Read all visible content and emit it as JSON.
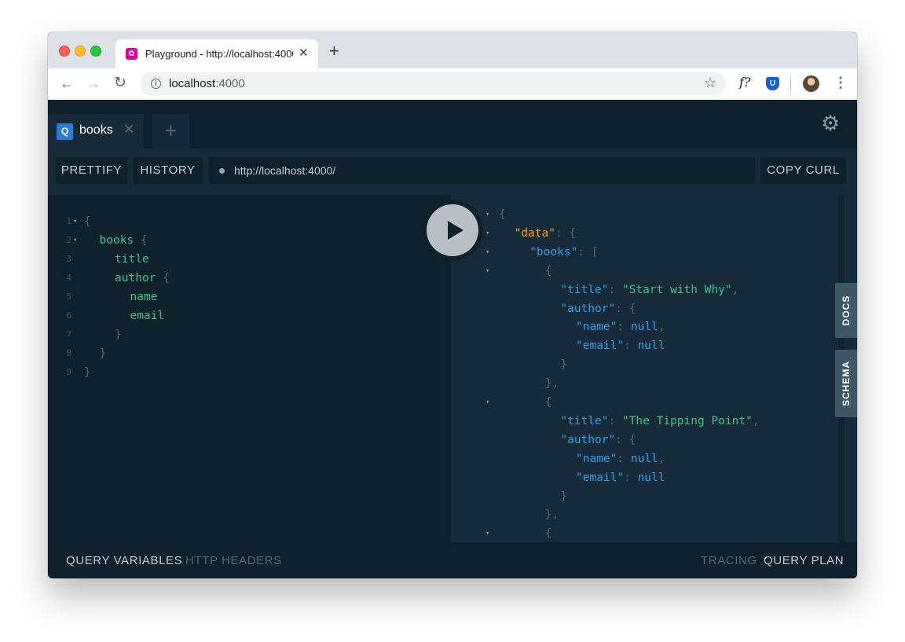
{
  "browser": {
    "tab_title": "Playground - http://localhost:4000",
    "tab_close": "✕",
    "new_tab": "+",
    "url_host": "localhost",
    "url_port": ":4000",
    "ext_f_label": "f?",
    "ext_shield_label": "U"
  },
  "playground": {
    "query_tab": {
      "badge": "Q",
      "label": "books",
      "close": "✕"
    },
    "new_tab": "+",
    "buttons": {
      "prettify": "PRETTIFY",
      "history": "HISTORY",
      "copy_curl": "COPY CURL"
    },
    "endpoint_url": "http://localhost:4000/",
    "side_tabs": {
      "docs": "DOCS",
      "schema": "SCHEMA"
    },
    "bottom": {
      "query_variables": "QUERY VARIABLES",
      "http_headers": "HTTP HEADERS",
      "tracing": "TRACING",
      "query_plan": "QUERY PLAN"
    }
  },
  "editor": {
    "lines": [
      {
        "num": "1",
        "fold": "▾",
        "indent": 0,
        "parts": [
          {
            "t": "{",
            "c": "punct"
          }
        ]
      },
      {
        "num": "2",
        "fold": "▾",
        "indent": 1,
        "parts": [
          {
            "t": "books",
            "c": "field"
          },
          {
            "t": " {",
            "c": "punct"
          }
        ]
      },
      {
        "num": "3",
        "fold": "",
        "indent": 2,
        "parts": [
          {
            "t": "title",
            "c": "field"
          }
        ]
      },
      {
        "num": "4",
        "fold": "",
        "indent": 2,
        "parts": [
          {
            "t": "author",
            "c": "field"
          },
          {
            "t": " {",
            "c": "punct"
          }
        ]
      },
      {
        "num": "5",
        "fold": "",
        "indent": 3,
        "parts": [
          {
            "t": "name",
            "c": "field"
          }
        ]
      },
      {
        "num": "6",
        "fold": "",
        "indent": 3,
        "parts": [
          {
            "t": "email",
            "c": "field"
          }
        ]
      },
      {
        "num": "7",
        "fold": "",
        "indent": 2,
        "parts": [
          {
            "t": "}",
            "c": "punct"
          }
        ]
      },
      {
        "num": "8",
        "fold": "",
        "indent": 1,
        "parts": [
          {
            "t": "}",
            "c": "punct"
          }
        ]
      },
      {
        "num": "9",
        "fold": "",
        "indent": 0,
        "parts": [
          {
            "t": "}",
            "c": "punct"
          }
        ]
      }
    ]
  },
  "result": {
    "lines": [
      {
        "fold": "▾",
        "indent": 0,
        "parts": [
          {
            "t": "{",
            "c": "punct"
          }
        ]
      },
      {
        "fold": "▾",
        "indent": 1,
        "parts": [
          {
            "t": "\"data\"",
            "c": "datakey"
          },
          {
            "t": ": {",
            "c": "punct"
          }
        ]
      },
      {
        "fold": "▾",
        "indent": 2,
        "parts": [
          {
            "t": "\"books\"",
            "c": "key"
          },
          {
            "t": ": [",
            "c": "punct"
          }
        ]
      },
      {
        "fold": "▾",
        "indent": 3,
        "parts": [
          {
            "t": "{",
            "c": "punct"
          }
        ]
      },
      {
        "fold": "",
        "indent": 4,
        "parts": [
          {
            "t": "\"title\"",
            "c": "key"
          },
          {
            "t": ": ",
            "c": "punct"
          },
          {
            "t": "\"Start with Why\"",
            "c": "str"
          },
          {
            "t": ",",
            "c": "punct"
          }
        ]
      },
      {
        "fold": "",
        "indent": 4,
        "parts": [
          {
            "t": "\"author\"",
            "c": "key"
          },
          {
            "t": ": {",
            "c": "punct"
          }
        ]
      },
      {
        "fold": "",
        "indent": 5,
        "parts": [
          {
            "t": "\"name\"",
            "c": "key"
          },
          {
            "t": ": ",
            "c": "punct"
          },
          {
            "t": "null",
            "c": "nullv"
          },
          {
            "t": ",",
            "c": "punct"
          }
        ]
      },
      {
        "fold": "",
        "indent": 5,
        "parts": [
          {
            "t": "\"email\"",
            "c": "key"
          },
          {
            "t": ": ",
            "c": "punct"
          },
          {
            "t": "null",
            "c": "nullv"
          }
        ]
      },
      {
        "fold": "",
        "indent": 4,
        "parts": [
          {
            "t": "}",
            "c": "punct"
          }
        ]
      },
      {
        "fold": "",
        "indent": 3,
        "parts": [
          {
            "t": "},",
            "c": "punct"
          }
        ]
      },
      {
        "fold": "▾",
        "indent": 3,
        "parts": [
          {
            "t": "{",
            "c": "punct"
          }
        ]
      },
      {
        "fold": "",
        "indent": 4,
        "parts": [
          {
            "t": "\"title\"",
            "c": "key"
          },
          {
            "t": ": ",
            "c": "punct"
          },
          {
            "t": "\"The Tipping Point\"",
            "c": "str"
          },
          {
            "t": ",",
            "c": "punct"
          }
        ]
      },
      {
        "fold": "",
        "indent": 4,
        "parts": [
          {
            "t": "\"author\"",
            "c": "key"
          },
          {
            "t": ": {",
            "c": "punct"
          }
        ]
      },
      {
        "fold": "",
        "indent": 5,
        "parts": [
          {
            "t": "\"name\"",
            "c": "key"
          },
          {
            "t": ": ",
            "c": "punct"
          },
          {
            "t": "null",
            "c": "nullv"
          },
          {
            "t": ",",
            "c": "punct"
          }
        ]
      },
      {
        "fold": "",
        "indent": 5,
        "parts": [
          {
            "t": "\"email\"",
            "c": "key"
          },
          {
            "t": ": ",
            "c": "punct"
          },
          {
            "t": "null",
            "c": "nullv"
          }
        ]
      },
      {
        "fold": "",
        "indent": 4,
        "parts": [
          {
            "t": "}",
            "c": "punct"
          }
        ]
      },
      {
        "fold": "",
        "indent": 3,
        "parts": [
          {
            "t": "},",
            "c": "punct"
          }
        ]
      },
      {
        "fold": "▾",
        "indent": 3,
        "parts": [
          {
            "t": "{",
            "c": "punct"
          }
        ]
      }
    ]
  }
}
